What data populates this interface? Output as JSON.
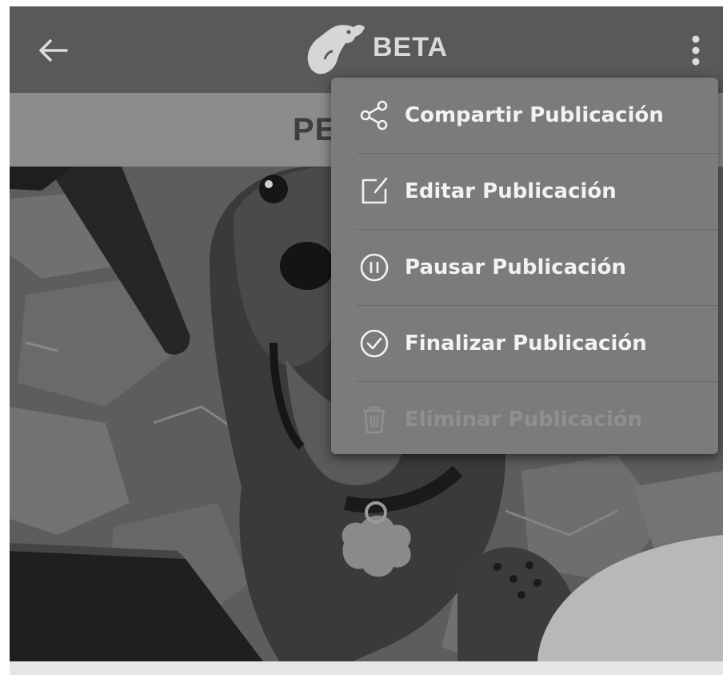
{
  "app_bar": {
    "logo_text": "BETA",
    "back_icon": "arrow-left-icon",
    "more_icon": "more-vertical-icon"
  },
  "section": {
    "title_visible": "PE"
  },
  "menu": {
    "items": [
      {
        "label": "Compartir Publicación",
        "icon": "share-icon",
        "enabled": true
      },
      {
        "label": "Editar Publicación",
        "icon": "edit-icon",
        "enabled": true
      },
      {
        "label": "Pausar Publicación",
        "icon": "pause-circle-icon",
        "enabled": true
      },
      {
        "label": "Finalizar Publicación",
        "icon": "check-circle-icon",
        "enabled": true
      },
      {
        "label": "Eliminar Publicación",
        "icon": "trash-icon",
        "enabled": false
      }
    ]
  },
  "colors": {
    "app_bar": "#595959",
    "section_bar": "#8c8c8c",
    "menu_bg": "#7b7b7b",
    "menu_text": "#f2f2f2",
    "menu_text_disabled": "#8f8f8f"
  }
}
